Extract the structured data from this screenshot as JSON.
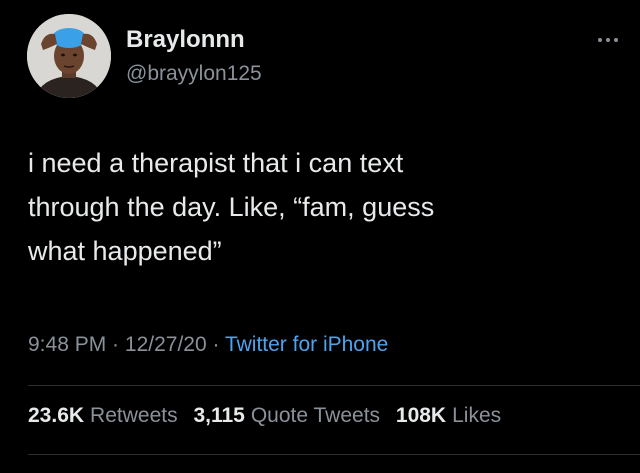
{
  "tweet": {
    "author": {
      "display_name": "Braylonnn",
      "handle": "@brayylon125",
      "avatar": "avatar-photo"
    },
    "more_icon": "more-dots-icon",
    "text_lines": [
      "i need a therapist that i can text",
      "through the day. Like, “fam, guess",
      "what happened”"
    ],
    "time": "9:48 PM",
    "sep1": " · ",
    "date": "12/27/20",
    "sep2": " · ",
    "source": "Twitter for iPhone",
    "stats": {
      "retweets": {
        "count": "23.6K",
        "label": "Retweets"
      },
      "quotes": {
        "count": "3,115",
        "label": "Quote Tweets"
      },
      "likes": {
        "count": "108K",
        "label": "Likes"
      }
    },
    "colors": {
      "background": "#000000",
      "text": "#e7e9ea",
      "secondary": "#8b9199",
      "link": "#4da3ee"
    }
  }
}
